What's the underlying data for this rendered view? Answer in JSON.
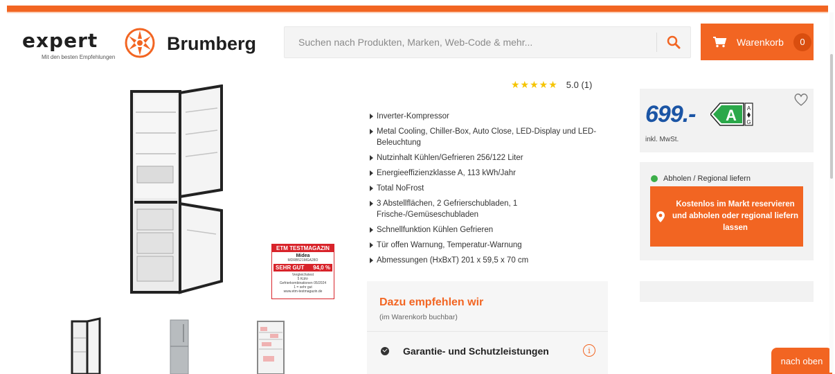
{
  "header": {
    "logo": {
      "brand": "expert",
      "city": "Brumberg",
      "tagline": "Mit den besten Empfehlungen"
    },
    "search": {
      "placeholder": "Suchen nach Produkten, Marken, Web-Code & mehr...",
      "value": ""
    },
    "cart": {
      "label": "Warenkorb",
      "count": "0"
    }
  },
  "product": {
    "badge": {
      "magazine": "ETM TESTMAGAZIN",
      "brand": "Midea",
      "model": "MDRB521MGA28O",
      "grade": "SEHR GUT",
      "score": "94,0 %",
      "category_1": "Vergleichstest",
      "category_2": "5 Kühl-",
      "category_3": "Gefrierkombinationen",
      "date": "05/2024",
      "scale": "1 = sehr gut",
      "url": "www.etm-testmagazin.de"
    },
    "rating": {
      "stars": "★★★★★",
      "text": "5.0 (1)"
    },
    "features": [
      "Inverter-Kompressor",
      "Metal Cooling, Chiller-Box, Auto Close, LED-Display und LED-Beleuchtung",
      "Nutzinhalt Kühlen/Gefrieren 256/122 Liter",
      "Energieeffizienzklasse A, 113 kWh/Jahr",
      "Total NoFrost",
      "3 Abstellflächen, 2 Gefrierschubladen, 1 Frische-/Gemüseschubladen",
      "Schnellfunktion Kühlen Gefrieren",
      "Tür offen Warnung, Temperatur-Warnung",
      "Abmessungen (HxBxT) 201 x 59,5 x 70 cm"
    ],
    "recommend": {
      "title": "Dazu empfehlen wir",
      "subtitle": "(im Warenkorb buchbar)",
      "item": "Garantie- und Schutzleistungen",
      "info_icon": "i"
    }
  },
  "sidebar": {
    "price": "699.-",
    "energy_class": "A",
    "energy_scale_top": "A",
    "energy_scale_bottom": "G",
    "vat": "inkl. MwSt.",
    "pickup_status": "Abholen / Regional liefern",
    "pickup_button": "Kostenlos im Markt reservieren und abholen oder regional liefern lassen"
  },
  "to_top": "nach oben",
  "colors": {
    "accent": "#f26522",
    "price": "#1b55a5",
    "energy": "#2ba84a",
    "available": "#3cae49"
  },
  "icons": [
    "search-icon",
    "cart-icon",
    "heart-icon",
    "location-pin-icon",
    "check-circle-icon",
    "info-icon"
  ]
}
